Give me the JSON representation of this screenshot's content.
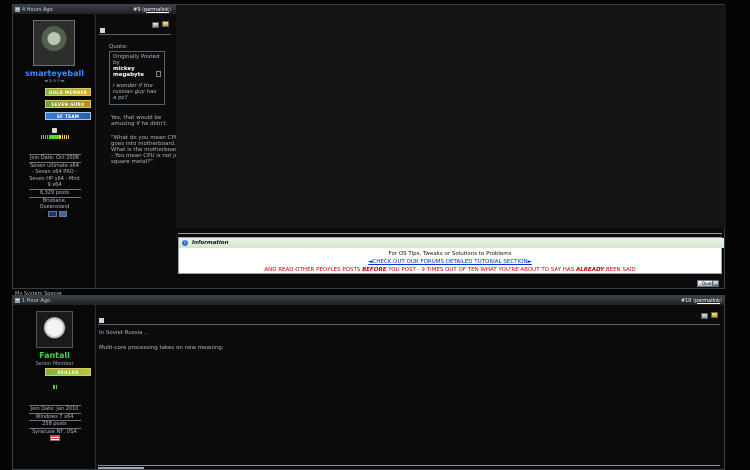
{
  "post1": {
    "time": "4 Hours Ago",
    "post_number": "#9",
    "permalink": "permalink",
    "user": {
      "name": "smarteyeball",
      "status_line": "◄ a o n ►",
      "badges": [
        "GOLD MEMBER",
        "SEVEN GURU",
        "SF TEAM"
      ],
      "join_date": "Join Date: Oct 2008",
      "os_lines": [
        "Seven ultimate x64",
        "- Seven x64 PRO -",
        "Seven HP x64 - Mint",
        "9 x64"
      ],
      "posts": "6,329 posts",
      "location": [
        "Brisbane,",
        "Queensland"
      ],
      "system_specs": "My System Specs▾"
    },
    "quote": {
      "label": "Quote:",
      "originally_posted_by": "Originally Posted by",
      "author": "mickey megabyte",
      "text": "i wonder if the russian guy has a pc?"
    },
    "body": [
      "Yes, that would be amusing if he didn't.",
      "\"What do you mean CPU goes into motherboard. What is the motherboard? - You mean CPU is not just square metal?\""
    ],
    "info": {
      "title": "Information",
      "line1": "For OS Tips, Tweaks or Solutions to Problems",
      "line2": "◄CHECK OUT OUR FORUMS DETAILED TUTORIAL SECTION►",
      "line3_a": "AND READ OTHER PEOPLES POSTS ",
      "line3_b": "BEFORE",
      "line3_c": " YOU POST - 9 TIMES OUT OF TEN WHAT YOU'RE ABOUT TO SAY HAS ",
      "line3_d": "ALREADY",
      "line3_e": " BEEN SAID"
    },
    "quote_button": "Quote"
  },
  "post2": {
    "time": "1 Hour Ago",
    "post_number": "#10",
    "permalink": "permalink",
    "user": {
      "name": "Fantall",
      "title": "Senior Member",
      "badge": "SKILLED",
      "join_date": "Join Date: Jan 2010",
      "os": "Windows 7 x64",
      "posts": "258 posts",
      "location": "Syracuse NY, USA"
    },
    "body": [
      "In Soviet Russia ..",
      "Multi-core processing takes on new meaning."
    ]
  },
  "colors": {
    "username_blue": "#2f8fff",
    "username_green": "#4ed14a",
    "link_blue": "#0033cc",
    "emphasis_red": "#cc0000"
  }
}
